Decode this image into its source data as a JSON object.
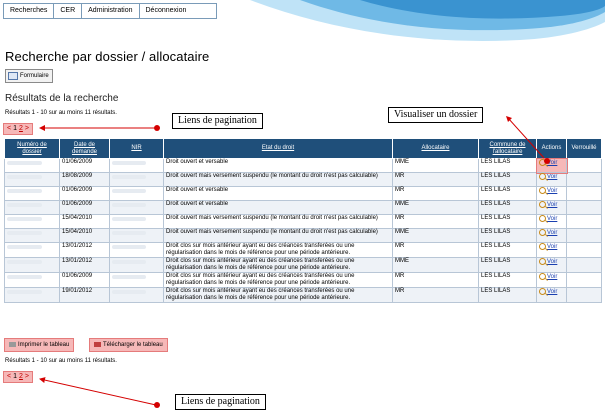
{
  "nav": [
    "Recherches",
    "CER",
    "Administration",
    "Déconnexion"
  ],
  "page_title": "Recherche par dossier / allocataire",
  "form_button": "Formulaire",
  "results_title": "Résultats de la recherche",
  "results_count": "Résultats 1 - 10 sur au moins 11 résultats.",
  "pagination": {
    "prev": "<",
    "p1": "1",
    "p2": "2",
    "next": ">"
  },
  "callouts": {
    "pagination_top": "Liens de pagination",
    "view_dossier": "Visualiser un dossier",
    "pagination_bottom": "Liens de pagination"
  },
  "table": {
    "headers": [
      "Numéro de dossier",
      "Date de demande",
      "NIR",
      "Etat du droit",
      "Allocataire",
      "Commune de l'allocataire",
      "Actions",
      "Verrouillé"
    ],
    "view_label": "Voir",
    "rows": [
      {
        "date": "01/06/2009",
        "etat": "Droit ouvert et versable",
        "alloc": "MME",
        "commune": "LES LILAS"
      },
      {
        "date": "18/08/2009",
        "etat": "Droit ouvert mais versement suspendu (le montant du droit n'est pas calculable)",
        "alloc": "MR",
        "commune": "LES LILAS"
      },
      {
        "date": "01/06/2009",
        "etat": "Droit ouvert et versable",
        "alloc": "MR",
        "commune": "LES LILAS"
      },
      {
        "date": "01/06/2009",
        "etat": "Droit ouvert et versable",
        "alloc": "MME",
        "commune": "LES LILAS"
      },
      {
        "date": "15/04/2010",
        "etat": "Droit ouvert mais versement suspendu (le montant du droit n'est pas calculable)",
        "alloc": "MR",
        "commune": "LES LILAS"
      },
      {
        "date": "15/04/2010",
        "etat": "Droit ouvert mais versement suspendu (le montant du droit n'est pas calculable)",
        "alloc": "MME",
        "commune": "LES LILAS"
      },
      {
        "date": "13/01/2012",
        "etat": "Droit clos sur mois antérieur ayant eu des créances transferées ou une régularisation dans le mois de référence pour une période antérieure.",
        "alloc": "MR",
        "commune": "LES LILAS"
      },
      {
        "date": "13/01/2012",
        "etat": "Droit clos sur mois antérieur ayant eu des créances transferées ou une régularisation dans le mois de référence pour une période antérieure.",
        "alloc": "MME",
        "commune": "LES LILAS"
      },
      {
        "date": "01/06/2009",
        "etat": "Droit clos sur mois antérieur ayant eu des créances transferées ou une régularisation dans le mois de référence pour une période antérieure.",
        "alloc": "MR",
        "commune": "LES LILAS"
      },
      {
        "date": "19/01/2012",
        "etat": "Droit clos sur mois antérieur ayant eu des créances transferées ou une régularisation dans le mois de référence pour une période antérieure.",
        "alloc": "MR",
        "commune": "LES LILAS"
      }
    ]
  },
  "export": {
    "print": "Imprimer le tableau",
    "download": "Télécharger le tableau"
  },
  "colors": {
    "header": "#1f4f7a",
    "highlight": "#f6b8b8",
    "arrow": "#d40000",
    "wave": "#6fb9e6"
  }
}
